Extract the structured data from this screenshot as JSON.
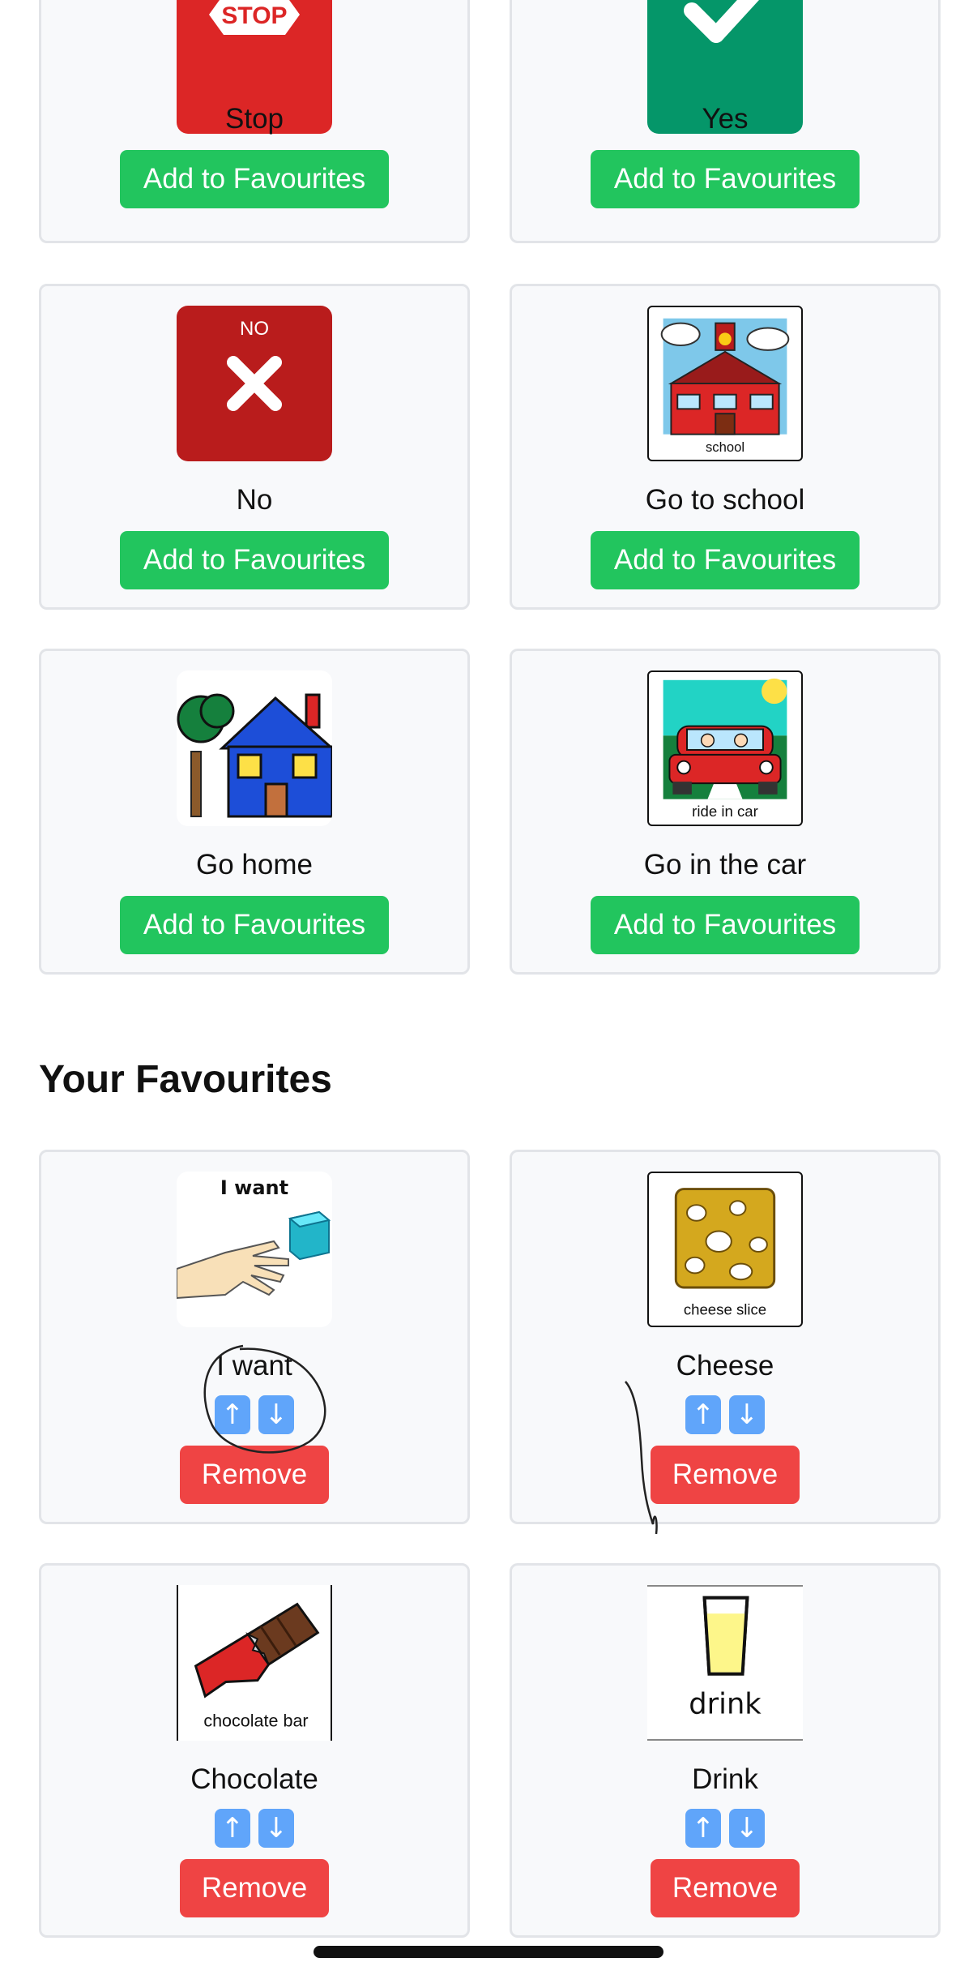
{
  "colors": {
    "accent_green": "#22c55e",
    "remove_red": "#ef4444",
    "arrow_blue": "#60a5fa",
    "card_bg": "#f8f9fb"
  },
  "symbols": {
    "stop": {
      "label": "Stop",
      "button": "Add to Favourites",
      "icon_text": "STOP"
    },
    "yes": {
      "label": "Yes",
      "button": "Add to Favourites"
    },
    "no": {
      "label": "No",
      "button": "Add to Favourites",
      "icon_text": "NO"
    },
    "school": {
      "label": "Go to school",
      "button": "Add to Favourites",
      "icon_caption": "school"
    },
    "home": {
      "label": "Go home",
      "button": "Add to Favourites"
    },
    "car": {
      "label": "Go in the car",
      "button": "Add to Favourites",
      "icon_caption": "ride in car"
    }
  },
  "favourites": {
    "title": "Your Favourites",
    "items": [
      {
        "label": "I want",
        "icon_caption": "I want",
        "up": "↑",
        "down": "↓",
        "remove": "Remove"
      },
      {
        "label": "Cheese",
        "icon_caption": "cheese slice",
        "up": "↑",
        "down": "↓",
        "remove": "Remove"
      },
      {
        "label": "Chocolate",
        "icon_caption": "chocolate bar",
        "up": "↑",
        "down": "↓",
        "remove": "Remove"
      },
      {
        "label": "Drink",
        "icon_caption": "drink",
        "up": "↑",
        "down": "↓",
        "remove": "Remove"
      }
    ]
  }
}
